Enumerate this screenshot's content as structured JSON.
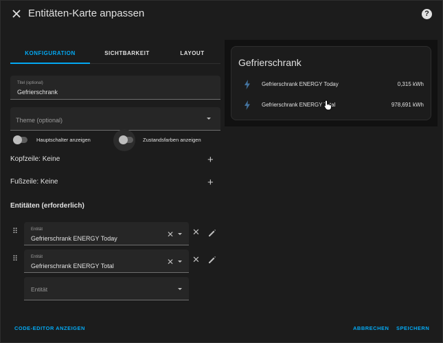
{
  "header": {
    "title": "Entitäten-Karte anpassen",
    "help_icon": "?"
  },
  "tabs": [
    {
      "label": "KONFIGURATION",
      "active": true
    },
    {
      "label": "SICHTBARKEIT",
      "active": false
    },
    {
      "label": "LAYOUT",
      "active": false
    }
  ],
  "form": {
    "title_field": {
      "label": "Titel (optional)",
      "value": "Gefrierschrank"
    },
    "theme_field": {
      "placeholder": "Theme (optional)"
    },
    "switches": [
      {
        "label": "Hauptschalter anzeigen",
        "on": false
      },
      {
        "label": "Zustandsfarben anzeigen",
        "on": false
      }
    ],
    "header_row": "Kopfzeile: Keine",
    "footer_row": "Fußzeile: Keine",
    "entities_title": "Entitäten (erforderlich)",
    "entities": [
      {
        "label": "Entität",
        "value": "Gefrierschrank ENERGY Today"
      },
      {
        "label": "Entität",
        "value": "Gefrierschrank ENERGY Total"
      }
    ],
    "new_entity": {
      "placeholder": "Entität"
    }
  },
  "footer": {
    "code_editor": "CODE-EDITOR ANZEIGEN",
    "cancel": "ABBRECHEN",
    "save": "SPEICHERN"
  },
  "preview": {
    "title": "Gefrierschrank",
    "rows": [
      {
        "name": "Gefrierschrank ENERGY Today",
        "value": "0,315 kWh"
      },
      {
        "name": "Gefrierschrank ENERGY Total",
        "value": "978,691 kWh"
      }
    ]
  },
  "colors": {
    "accent": "#03a9f4",
    "background": "#1c1c1c",
    "field": "#262626",
    "bolt": "#44739e"
  }
}
